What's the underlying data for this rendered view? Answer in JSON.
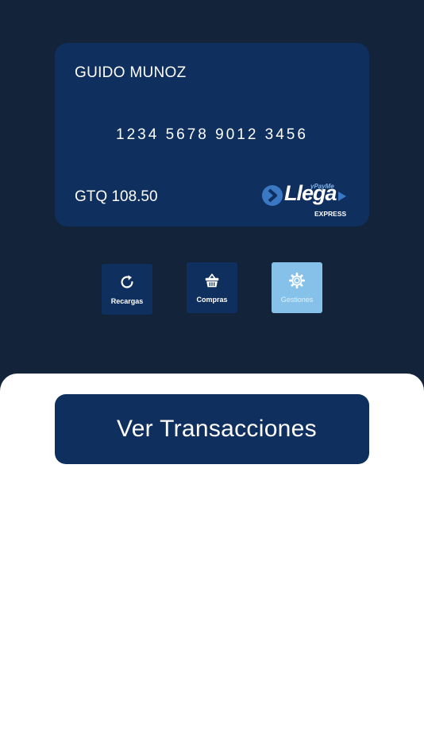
{
  "card": {
    "holder_name": "GUIDO MUNOZ",
    "number": "1234 5678 9012 3456",
    "balance": "GTQ 108.50",
    "brand": {
      "name": "Llega",
      "tag": "yPayMe",
      "subtitle": "EXPRESS",
      "icon": "chevron-right-circle-icon"
    }
  },
  "actions": [
    {
      "label": "Recargas",
      "icon": "refresh-icon",
      "enabled": true
    },
    {
      "label": "Compras",
      "icon": "basket-icon",
      "enabled": true
    },
    {
      "label": "Gestiones",
      "icon": "gear-icon",
      "enabled": false
    }
  ],
  "sheet": {
    "primary_button_label": "Ver Transacciones"
  },
  "colors": {
    "background": "#12233a",
    "card": "#0f2f5f",
    "action_disabled": "#86c1ea",
    "brand_accent": "#3b78c4",
    "sheet": "#ffffff"
  }
}
